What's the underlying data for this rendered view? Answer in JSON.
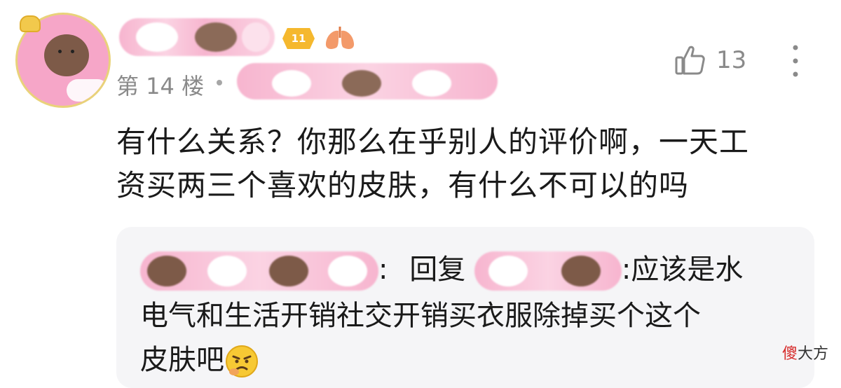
{
  "comment": {
    "level": "11",
    "floor": "第 14 楼",
    "likes": "13",
    "text_line1": "有什么关系？你那么在乎别人的评价啊，一天工",
    "text_line2": "资买两三个喜欢的皮肤，有什么不可以的吗"
  },
  "reply": {
    "separator": ":",
    "reply_label": "回复",
    "line1_text": ":应该是水",
    "line2_text": "电气和生活开销社交开销买衣服除掉买个这个",
    "line3_text": "皮肤吧"
  },
  "watermark": {
    "accent": "傻",
    "rest": "大方"
  },
  "icons": {
    "like": "thumbs-up-icon",
    "more": "vertical-ellipsis-icon",
    "badge": "lung-badge-icon",
    "emoji": "angry-emoji-icon"
  },
  "colors": {
    "level_badge": "#f5b82e",
    "reply_background": "#f5f5f7",
    "meta_text": "#8a8a8a",
    "watermark_accent": "#d62a2a"
  }
}
